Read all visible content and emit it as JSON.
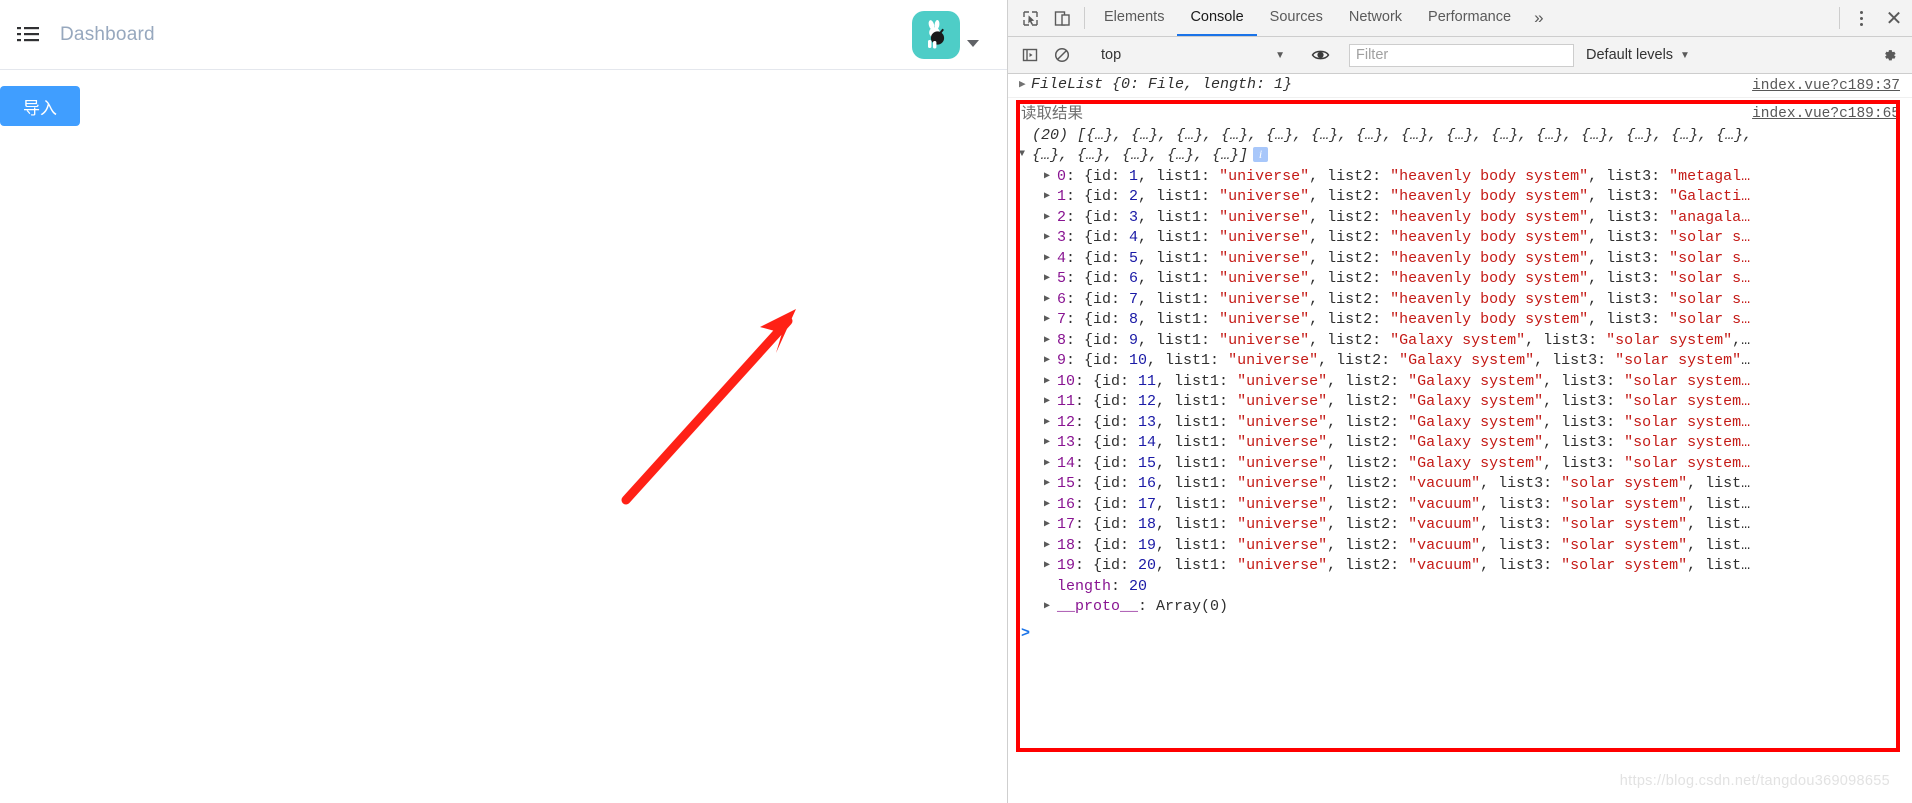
{
  "page": {
    "menu_icon": "hamburger-menu-icon",
    "breadcrumb": "Dashboard",
    "avatar_icon": "rabbit-avatar-icon",
    "import_button": "导入"
  },
  "devtools": {
    "inspect_icon": "inspect-element-icon",
    "device_icon": "device-toolbar-icon",
    "tabs": [
      {
        "label": "Elements",
        "active": false
      },
      {
        "label": "Console",
        "active": true
      },
      {
        "label": "Sources",
        "active": false
      },
      {
        "label": "Network",
        "active": false
      },
      {
        "label": "Performance",
        "active": false
      }
    ],
    "more_tabs_icon": "chevron-double-right-icon",
    "kebab_icon": "more-options-icon",
    "close_icon": "close-icon",
    "toolbar": {
      "sidebar_icon": "console-sidebar-icon",
      "clear_icon": "clear-console-icon",
      "context": "top",
      "context_caret": "▼",
      "eye_icon": "live-expression-icon",
      "filter_placeholder": "Filter",
      "filter_value": "",
      "levels": "Default levels",
      "levels_caret": "▼",
      "settings_icon": "gear-icon"
    }
  },
  "console": {
    "entry1": {
      "disclosure": "▶",
      "text": "FileList {0: File, length: 1}",
      "source": "index.vue?c189:37"
    },
    "entry2": {
      "label": "读取结果",
      "source": "index.vue?c189:65",
      "array_caret": "▼",
      "array_preview": "(20) [{…}, {…}, {…}, {…}, {…}, {…}, {…}, {…}, {…}, {…}, {…}, {…}, {…}, {…}, {…}, {…}, {…}, {…}, {…}, {…}]",
      "info_badge": "i",
      "items": [
        {
          "index": "0",
          "id": "1",
          "list1": "universe",
          "list2": "heavenly body system",
          "list3": "metagal…",
          "trail": ""
        },
        {
          "index": "1",
          "id": "2",
          "list1": "universe",
          "list2": "heavenly body system",
          "list3": "Galacti…",
          "trail": ""
        },
        {
          "index": "2",
          "id": "3",
          "list1": "universe",
          "list2": "heavenly body system",
          "list3": "anagala…",
          "trail": ""
        },
        {
          "index": "3",
          "id": "4",
          "list1": "universe",
          "list2": "heavenly body system",
          "list3": "solar s…",
          "trail": ""
        },
        {
          "index": "4",
          "id": "5",
          "list1": "universe",
          "list2": "heavenly body system",
          "list3": "solar s…",
          "trail": ""
        },
        {
          "index": "5",
          "id": "6",
          "list1": "universe",
          "list2": "heavenly body system",
          "list3": "solar s…",
          "trail": ""
        },
        {
          "index": "6",
          "id": "7",
          "list1": "universe",
          "list2": "heavenly body system",
          "list3": "solar s…",
          "trail": ""
        },
        {
          "index": "7",
          "id": "8",
          "list1": "universe",
          "list2": "heavenly body system",
          "list3": "solar s…",
          "trail": ""
        },
        {
          "index": "8",
          "id": "9",
          "list1": "universe",
          "list2": "Galaxy system",
          "list3": "solar system",
          "trail": ",…"
        },
        {
          "index": "9",
          "id": "10",
          "list1": "universe",
          "list2": "Galaxy system",
          "list3": "solar system",
          "trail": "…"
        },
        {
          "index": "10",
          "id": "11",
          "list1": "universe",
          "list2": "Galaxy system",
          "list3": "solar system…",
          "trail": ""
        },
        {
          "index": "11",
          "id": "12",
          "list1": "universe",
          "list2": "Galaxy system",
          "list3": "solar system…",
          "trail": ""
        },
        {
          "index": "12",
          "id": "13",
          "list1": "universe",
          "list2": "Galaxy system",
          "list3": "solar system…",
          "trail": ""
        },
        {
          "index": "13",
          "id": "14",
          "list1": "universe",
          "list2": "Galaxy system",
          "list3": "solar system…",
          "trail": ""
        },
        {
          "index": "14",
          "id": "15",
          "list1": "universe",
          "list2": "Galaxy system",
          "list3": "solar system…",
          "trail": ""
        },
        {
          "index": "15",
          "id": "16",
          "list1": "universe",
          "list2": "vacuum",
          "list3": "solar system",
          "trail": ", list…"
        },
        {
          "index": "16",
          "id": "17",
          "list1": "universe",
          "list2": "vacuum",
          "list3": "solar system",
          "trail": ", list…"
        },
        {
          "index": "17",
          "id": "18",
          "list1": "universe",
          "list2": "vacuum",
          "list3": "solar system",
          "trail": ", list…"
        },
        {
          "index": "18",
          "id": "19",
          "list1": "universe",
          "list2": "vacuum",
          "list3": "solar system",
          "trail": ", list…"
        },
        {
          "index": "19",
          "id": "20",
          "list1": "universe",
          "list2": "vacuum",
          "list3": "solar system",
          "trail": ", list…"
        }
      ],
      "length_key": "length",
      "length_value": "20",
      "proto_key": "__proto__",
      "proto_value": "Array(0)"
    },
    "prompt": ">",
    "watermark": "https://blog.csdn.net/tangdou369098655"
  },
  "colors": {
    "accent_blue": "#409eff",
    "devtools_tab_active": "#1a73e8",
    "string_red": "#c41a16",
    "number_blue": "#1a1aa6",
    "key_purple": "#881391",
    "annotation_red": "#ff0000",
    "avatar_teal": "#4ecdc7"
  }
}
